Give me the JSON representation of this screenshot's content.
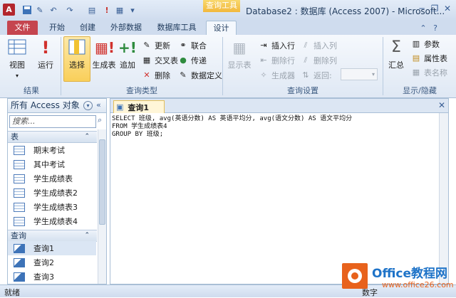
{
  "title_bar": {
    "app_icon_label": "A",
    "context_tab_group": "查询工具",
    "window_title": "Database2 : 数据库 (Access 2007) - Microsoft...",
    "minimize": "─",
    "restore": "❐",
    "close": "✕"
  },
  "tabs": {
    "file": "文件",
    "home": "开始",
    "create": "创建",
    "external": "外部数据",
    "dbtools": "数据库工具",
    "design": "设计"
  },
  "ribbon": {
    "results": {
      "label": "结果",
      "view": "视图",
      "run": "运行"
    },
    "query_type": {
      "label": "查询类型",
      "select": "选择",
      "make_table": "生成表",
      "append": "追加",
      "update": "更新",
      "crosstab": "交叉表",
      "delete": "删除",
      "union": "联合",
      "passthrough": "传递",
      "data_def": "数据定义"
    },
    "query_setup": {
      "label": "查询设置",
      "show_table": "显示表",
      "insert_rows": "插入行",
      "delete_rows": "删除行",
      "builder": "生成器",
      "insert_cols": "插入列",
      "delete_cols": "删除列",
      "return": "返回:"
    },
    "show_hide": {
      "label": "显示/隐藏",
      "totals": "汇总",
      "params": "参数",
      "property_sheet": "属性表",
      "table_names": "表名称"
    }
  },
  "nav": {
    "header": "所有 Access 对象",
    "search_placeholder": "搜索...",
    "tables_label": "表",
    "tables": [
      "期末考试",
      "其中考试",
      "学生成绩表",
      "学生成绩表2",
      "学生成绩表3",
      "学生成绩表4"
    ],
    "queries_label": "查询",
    "queries": [
      "查询1",
      "查询2",
      "查询3"
    ]
  },
  "document": {
    "tab_label": "查询1",
    "sql_lines": [
      "SELECT 班级, avg(英语分数) AS 英语平均分, avg(语文分数) AS 语文平均分",
      "FROM 学生成绩表4",
      "GROUP BY 班级;"
    ]
  },
  "status": {
    "left": "就绪",
    "right": "数字"
  },
  "watermark": {
    "brand": "Office教程网",
    "url": "www.office26.com"
  }
}
